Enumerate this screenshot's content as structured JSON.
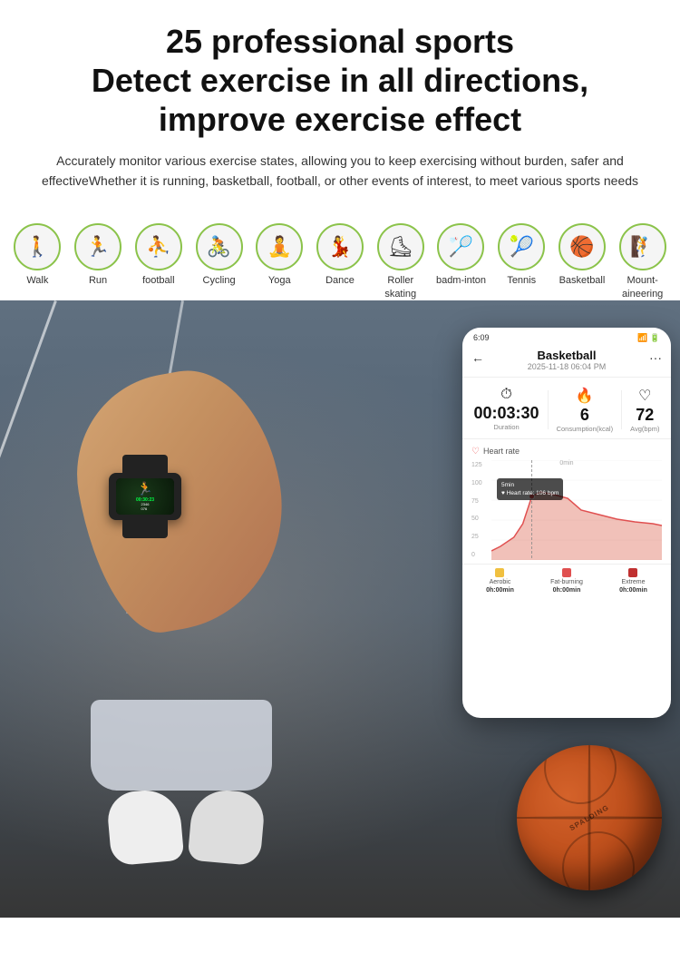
{
  "header": {
    "main_title": "25 professional sports\nDetect exercise in all directions,\nimprove exercise effect",
    "subtitle": "Accurately monitor various exercise states, allowing you to keep exercising without burden, safer and effectiveWhether it is running, basketball, football, or other events of interest, to meet various sports needs"
  },
  "sports": [
    {
      "id": "walk",
      "label": "Walk",
      "icon": "🚶"
    },
    {
      "id": "run",
      "label": "Run",
      "icon": "🏃"
    },
    {
      "id": "football",
      "label": "football",
      "icon": "⛹"
    },
    {
      "id": "cycling",
      "label": "Cycling",
      "icon": "🚴"
    },
    {
      "id": "yoga",
      "label": "Yoga",
      "icon": "🧘"
    },
    {
      "id": "dance",
      "label": "Dance",
      "icon": "💃"
    },
    {
      "id": "roller",
      "label": "Roller skating",
      "icon": "⛸"
    },
    {
      "id": "badminton",
      "label": "badm-inton",
      "icon": "🏸"
    },
    {
      "id": "tennis",
      "label": "Tennis",
      "icon": "🎾"
    },
    {
      "id": "basketball",
      "label": "Basketball",
      "icon": "🏀"
    },
    {
      "id": "mountaineering",
      "label": "Mount-aineering",
      "icon": "🧗"
    }
  ],
  "watch": {
    "time": "00:30:23",
    "stat1": "2346",
    "stat2": "076"
  },
  "phone": {
    "status_time": "6:09",
    "activity_title": "Basketball",
    "activity_date": "2025-11-18 06:04 PM",
    "back_icon": "←",
    "more_icon": "···",
    "stats": [
      {
        "icon": "⏱",
        "value": "00:03:30",
        "label": "Duration"
      },
      {
        "icon": "🔥",
        "value": "6",
        "label": "Consumption(kcal)"
      },
      {
        "icon": "♡",
        "value": "72",
        "label": "Avg(bpm)"
      }
    ],
    "heart_rate_label": "Heart rate",
    "chart": {
      "y_labels": [
        "125",
        "100",
        "75",
        "50",
        "25",
        "0"
      ],
      "x_label": "0min",
      "tooltip_time": "5min",
      "tooltip_hr": "Heart rate: 106 bpm"
    },
    "legend": [
      {
        "color": "#f0c040",
        "name": "Aerobic",
        "time": "0h:00min"
      },
      {
        "color": "#e05050",
        "name": "Fat-burning",
        "time": "0h:00min"
      },
      {
        "color": "#c03030",
        "name": "Extreme",
        "time": "0h:00min"
      }
    ]
  },
  "colors": {
    "accent_green": "#8bc34a",
    "watch_screen_green": "#00ff44",
    "basketball_orange": "#d4622a"
  }
}
